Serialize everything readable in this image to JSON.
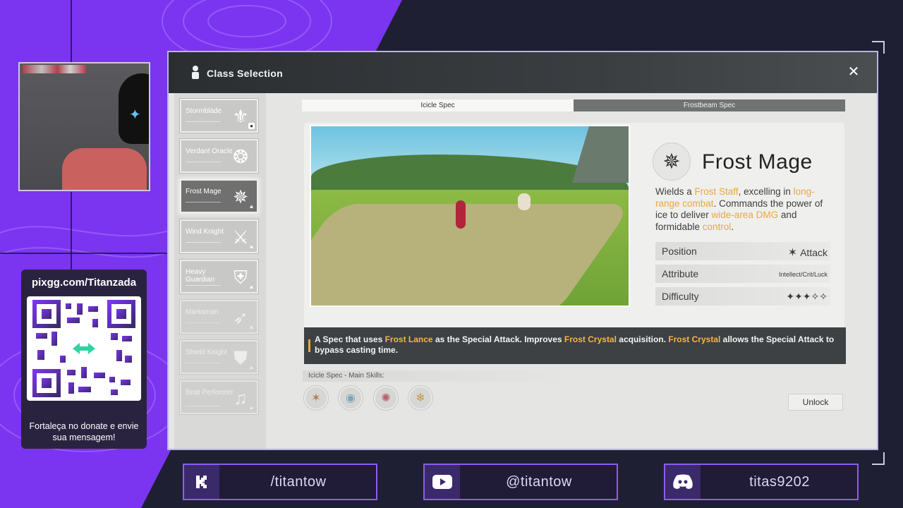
{
  "overlay": {
    "donate_url": "pixgg.com/Titanzada",
    "donate_caption": "Fortaleça no donate e envie sua mensagem!",
    "socials": [
      {
        "icon": "kick-icon",
        "handle": "/titantow"
      },
      {
        "icon": "youtube-icon",
        "handle": "@titantow"
      },
      {
        "icon": "discord-icon",
        "handle": "titas9202"
      }
    ],
    "colors": {
      "purple": "#7b35f0",
      "dark": "#1f1f33",
      "accent": "#e9a93b"
    }
  },
  "game": {
    "title": "Class Selection",
    "classes": [
      {
        "name": "Stormblade",
        "emblem": "⚜"
      },
      {
        "name": "Verdant Oracle",
        "emblem": "❂"
      },
      {
        "name": "Frost Mage",
        "emblem": "✵"
      },
      {
        "name": "Wind Knight",
        "emblem": "⚔"
      },
      {
        "name": "Heavy Guardian",
        "emblem": "⛨"
      },
      {
        "name": "Marksman",
        "emblem": "➶"
      },
      {
        "name": "Shield Knight",
        "emblem": "⛊"
      },
      {
        "name": "Beat Performer",
        "emblem": "♫"
      }
    ],
    "tabs": [
      "Icicle Spec",
      "Frostbeam Spec"
    ],
    "class_name": "Frost Mage",
    "description": {
      "p1": "Wields a ",
      "h1": "Frost Staff",
      "p2": ", excelling in ",
      "h2": "long-range combat",
      "p3": ". Commands the power of ice to deliver ",
      "h3": "wide-area DMG",
      "p4": " and formidable ",
      "h4": "control",
      "p5": "."
    },
    "attributes": [
      {
        "label": "Position",
        "value": "Attack"
      },
      {
        "label": "Attribute",
        "value": "Intellect/Crit/Luck"
      },
      {
        "label": "Difficulty",
        "value": "✦✦✦✧✧"
      }
    ],
    "spec_text": {
      "p1": "A Spec that uses ",
      "h1": "Frost Lance",
      "p2": " as the Special Attack. Improves ",
      "h2": "Frost Crystal",
      "p3": " acquisition. ",
      "h3": "Frost Crystal",
      "p4": " allows the Special Attack to bypass casting time."
    },
    "skills_label": "Icicle Spec - Main Skills:",
    "unlock_label": "Unlock"
  }
}
